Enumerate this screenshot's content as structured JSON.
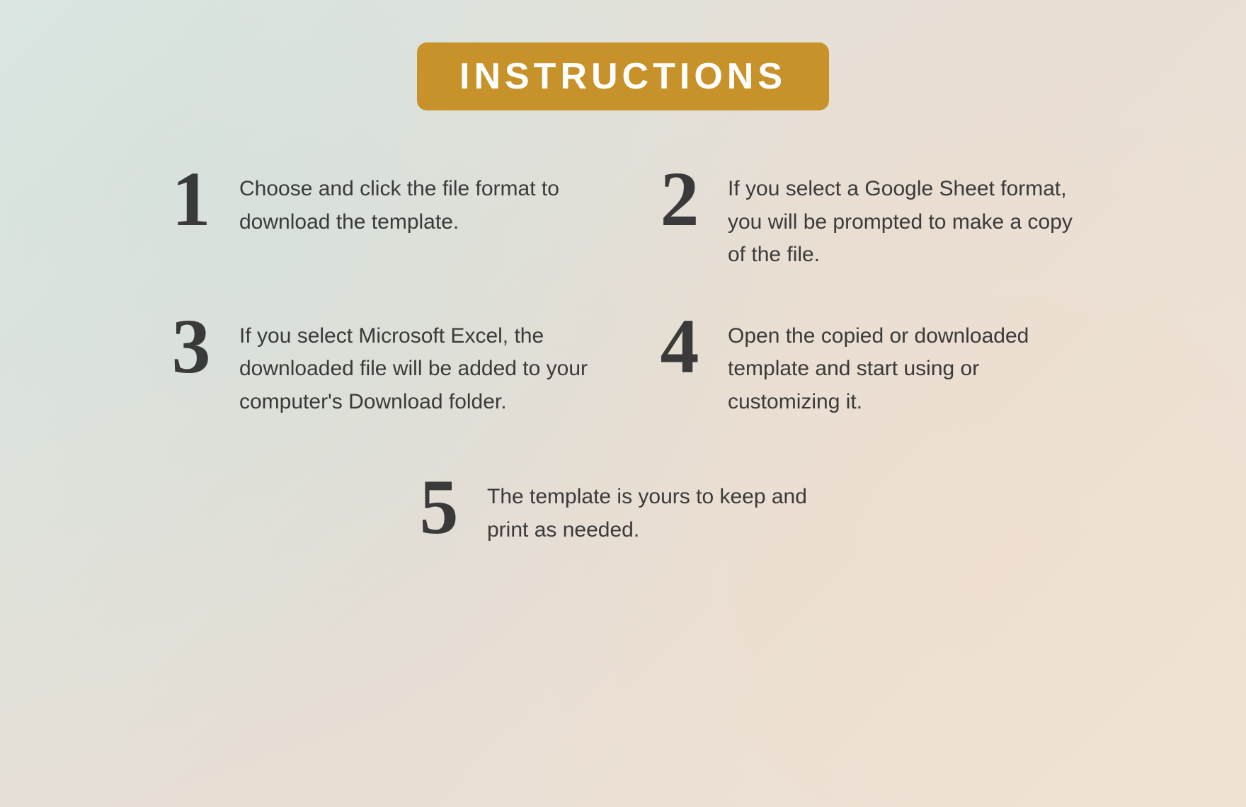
{
  "page": {
    "title": "INSTRUCTIONS",
    "background_gradient_start": "#dce8e4",
    "background_gradient_end": "#f0e4d8",
    "title_badge_color": "#c8922a"
  },
  "steps": [
    {
      "number": "1",
      "text": "Choose and click the file format to download the template."
    },
    {
      "number": "2",
      "text": "If you select a Google Sheet format, you will be prompted to make a copy of the file."
    },
    {
      "number": "3",
      "text": "If you select Microsoft Excel, the downloaded file will be added to your computer's Download  folder."
    },
    {
      "number": "4",
      "text": "Open the copied or downloaded template and start using or customizing it."
    },
    {
      "number": "5",
      "text": "The template is yours to keep and print as needed."
    }
  ]
}
